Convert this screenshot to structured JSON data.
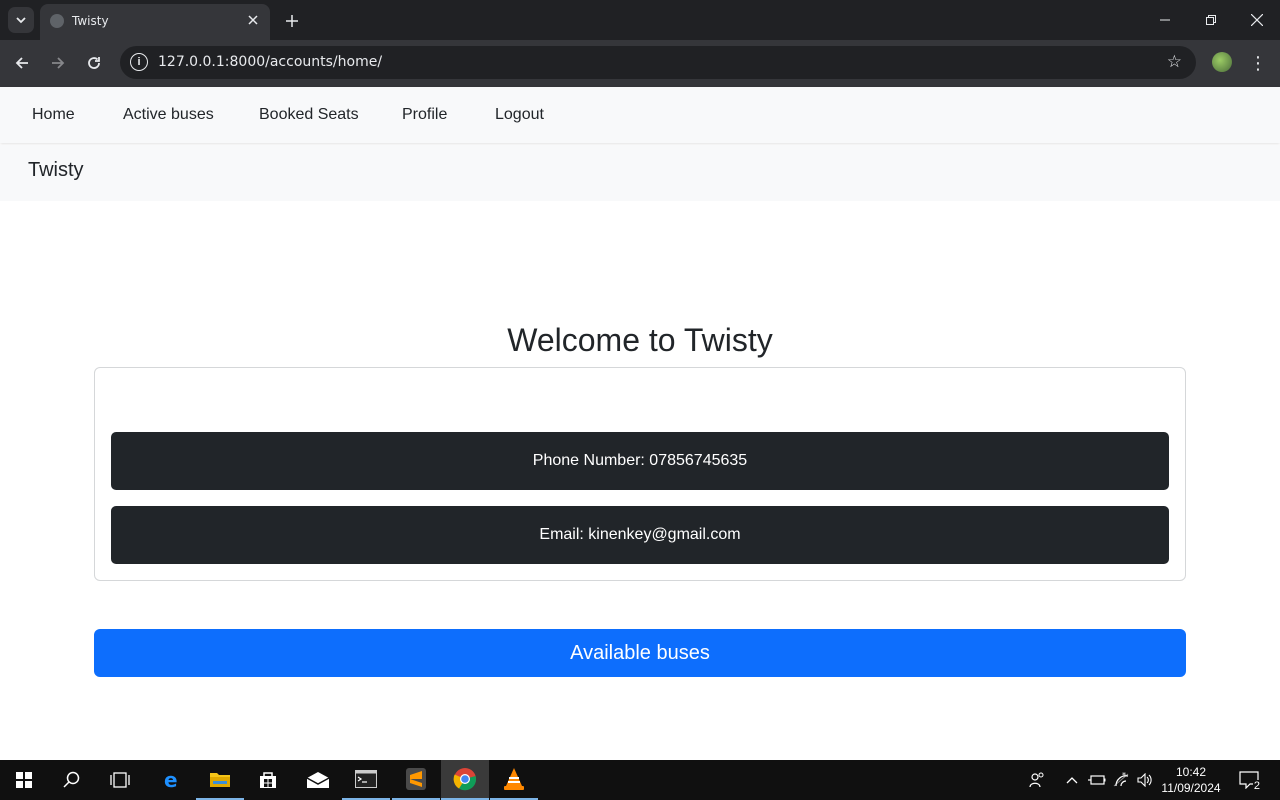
{
  "browser": {
    "tab_title": "Twisty",
    "url": "127.0.0.1:8000/accounts/home/"
  },
  "nav": {
    "items": [
      {
        "label": "Home"
      },
      {
        "label": "Active buses"
      },
      {
        "label": "Booked Seats"
      },
      {
        "label": "Profile"
      },
      {
        "label": "Logout"
      }
    ]
  },
  "brand": "Twisty",
  "main": {
    "welcome": "Welcome to Twisty",
    "phone": "Phone Number: 07856745635",
    "email": "Email: kinenkey@gmail.com",
    "available_buses_label": "Available buses"
  },
  "taskbar": {
    "time": "10:42",
    "date": "11/09/2024",
    "notification_count": "2"
  },
  "colors": {
    "primary": "#0d6efd",
    "dark": "#212529",
    "navbar": "#f8f9fa"
  }
}
